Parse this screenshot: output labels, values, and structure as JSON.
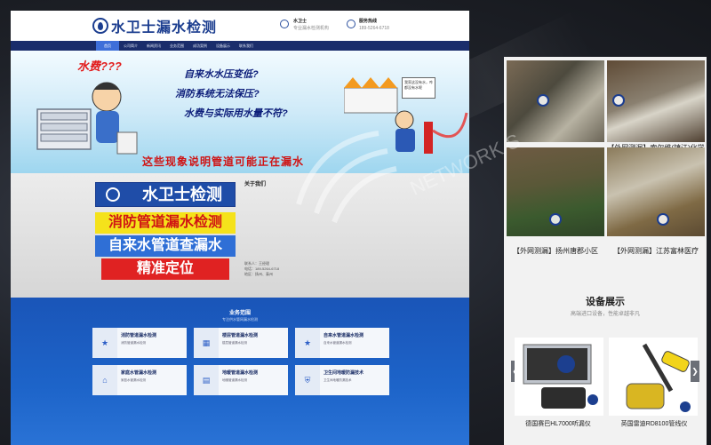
{
  "site": {
    "logo_text": "水卫士漏水检测",
    "brand_name": "水卫士",
    "brand_sub": "专业漏水检测机构",
    "hotline_label": "服务热线",
    "hotline_number": "189-5264-6718",
    "nav": [
      "首页",
      "公司简介",
      "新闻资讯",
      "业务范围",
      "成功案例",
      "设备展示",
      "联系我们"
    ],
    "active_nav": 0
  },
  "banner": {
    "water_fee": "水费???",
    "lines": [
      "自来水水压变低?",
      "消防系统无法保压?",
      "水费与实际用水量不符?"
    ],
    "sign_text": "我家这没有水，咋都没有水呢",
    "bottom": "这些现象说明管道可能正在漏水"
  },
  "promo": {
    "line1": "水卫士检测",
    "line2": "消防管道漏水检测",
    "line3": "自来水管道查漏水",
    "line4": "精准定位",
    "colors": {
      "yellow": "#f5e21b",
      "blue": "#2f6fd6",
      "red": "#e02222",
      "text_red": "#d01414",
      "text_white": "#ffffff"
    }
  },
  "about": {
    "title": "关于我们",
    "contact_label": "联系人：",
    "contact_name": "王经理",
    "phone_label": "电话：",
    "phone": "189-5264-6718",
    "area_label": "地区：",
    "area": "扬州、泰州"
  },
  "services": {
    "title": "业务范围",
    "subtitle": "专注供水管网漏水检测",
    "cards": [
      {
        "title": "消防管道漏水检测",
        "desc": "消防管道漏水检测"
      },
      {
        "title": "楼层管道漏水检测",
        "desc": "楼层管道漏水检测"
      },
      {
        "title": "自来水管道漏水检测",
        "desc": "自来水管道漏水检测"
      },
      {
        "title": "家庭水管漏水检测",
        "desc": "家庭水管漏水检测"
      },
      {
        "title": "地暖管道漏水检测",
        "desc": "地暖管道漏水检测"
      },
      {
        "title": "卫生间地暖防漏技术",
        "desc": "卫生间地暖防漏技术"
      }
    ]
  },
  "right_panel": {
    "cases": [
      {
        "caption": "【家庭测漏】扬中惠众花苑"
      },
      {
        "caption": "【外网测漏】索尔维(镇江)化学品"
      },
      {
        "caption": "【外网测漏】扬州唐郡小区"
      },
      {
        "caption": "【外网测漏】江苏富林医疗"
      }
    ],
    "equip_title": "设备展示",
    "equip_sub": "高端进口设备，性能卓越非凡",
    "products": [
      {
        "caption": "德国赛巴HL7000听漏仪"
      },
      {
        "caption": "英国雷迪RD8100管线仪"
      }
    ],
    "prev_arrow": "❮",
    "next_arrow": "❯"
  },
  "watermark": {
    "text": "NETWORK S",
    "icon": "water-drop-icon"
  }
}
